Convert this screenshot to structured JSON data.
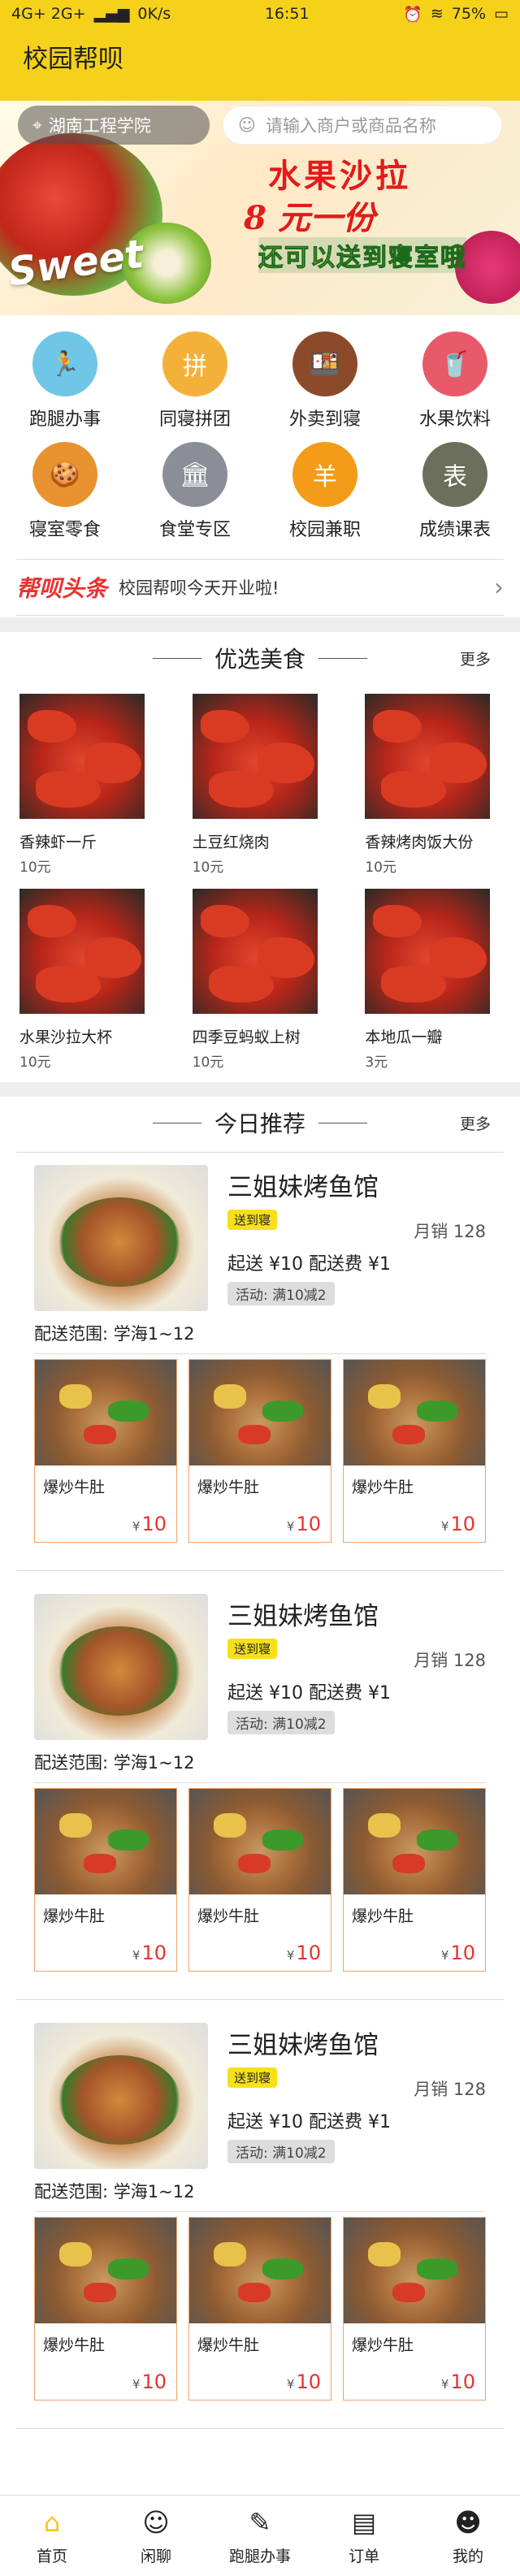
{
  "status": {
    "network": "4G+ 2G+",
    "speed": "0K/s",
    "time": "16:51",
    "battery": "75%"
  },
  "app": {
    "title": "校园帮呗"
  },
  "location": {
    "school": "湖南工程学院"
  },
  "search": {
    "placeholder": "请输入商户或商品名称"
  },
  "banner": {
    "line1": "水果沙拉",
    "line2": "8 元一份",
    "line3": "还可以送到寝室哦",
    "sweet": "Sweet"
  },
  "categories": [
    {
      "label": "跑腿办事",
      "icon": "errand-icon",
      "color": "#6fc6e7"
    },
    {
      "label": "同寝拼团",
      "icon": "group-buy-icon",
      "color": "#f4b13a"
    },
    {
      "label": "外卖到寝",
      "icon": "takeout-icon",
      "color": "#8b4b2a"
    },
    {
      "label": "水果饮料",
      "icon": "drink-icon",
      "color": "#e85a6a"
    },
    {
      "label": "寝室零食",
      "icon": "snack-icon",
      "color": "#e8922f"
    },
    {
      "label": "食堂专区",
      "icon": "canteen-icon",
      "color": "#8a8e96"
    },
    {
      "label": "校园兼职",
      "icon": "parttime-icon",
      "color": "#f49b1a"
    },
    {
      "label": "成绩课表",
      "icon": "schedule-icon",
      "color": "#6b6f5b"
    }
  ],
  "headline": {
    "logo": "帮呗头条",
    "text": "校园帮呗今天开业啦!"
  },
  "featured": {
    "title": "优选美食",
    "more": "更多",
    "items": [
      {
        "name": "香辣虾一斤",
        "price": "10元"
      },
      {
        "name": "土豆红烧肉",
        "price": "10元"
      },
      {
        "name": "香辣烤肉饭大份",
        "price": "10元"
      },
      {
        "name": "水果沙拉大杯",
        "price": "10元"
      },
      {
        "name": "四季豆蚂蚁上树",
        "price": "10元"
      },
      {
        "name": "本地瓜一瓣",
        "price": "3元"
      }
    ]
  },
  "recommend": {
    "title": "今日推荐",
    "more": "更多",
    "shops": [
      {
        "name": "三姐妹烤鱼馆",
        "tag": "送到寝",
        "monthly": "月销  128",
        "min": "起送 ¥10",
        "fee": "配送费 ¥1",
        "promo": "活动: 满10减2",
        "range": "配送范围: 学海1~12",
        "dishes": [
          {
            "name": "爆炒牛肚",
            "currency": "¥",
            "price": "10"
          },
          {
            "name": "爆炒牛肚",
            "currency": "¥",
            "price": "10"
          },
          {
            "name": "爆炒牛肚",
            "currency": "¥",
            "price": "10"
          }
        ]
      },
      {
        "name": "三姐妹烤鱼馆",
        "tag": "送到寝",
        "monthly": "月销  128",
        "min": "起送 ¥10",
        "fee": "配送费 ¥1",
        "promo": "活动: 满10减2",
        "range": "配送范围: 学海1~12",
        "dishes": [
          {
            "name": "爆炒牛肚",
            "currency": "¥",
            "price": "10"
          },
          {
            "name": "爆炒牛肚",
            "currency": "¥",
            "price": "10"
          },
          {
            "name": "爆炒牛肚",
            "currency": "¥",
            "price": "10"
          }
        ]
      },
      {
        "name": "三姐妹烤鱼馆",
        "tag": "送到寝",
        "monthly": "月销  128",
        "min": "起送 ¥10",
        "fee": "配送费 ¥1",
        "promo": "活动: 满10减2",
        "range": "配送范围: 学海1~12",
        "dishes": [
          {
            "name": "爆炒牛肚",
            "currency": "¥",
            "price": "10"
          },
          {
            "name": "爆炒牛肚",
            "currency": "¥",
            "price": "10"
          },
          {
            "name": "爆炒牛肚",
            "currency": "¥",
            "price": "10"
          }
        ]
      }
    ]
  },
  "tabs": [
    {
      "label": "首页",
      "icon": "home-icon"
    },
    {
      "label": "闲聊",
      "icon": "chat-icon"
    },
    {
      "label": "跑腿办事",
      "icon": "errand-pen-icon"
    },
    {
      "label": "订单",
      "icon": "order-icon"
    },
    {
      "label": "我的",
      "icon": "profile-icon"
    }
  ],
  "colors": {
    "brand": "#f6d11a",
    "price": "#e8322f",
    "dishBorder": "#f0a36a"
  }
}
